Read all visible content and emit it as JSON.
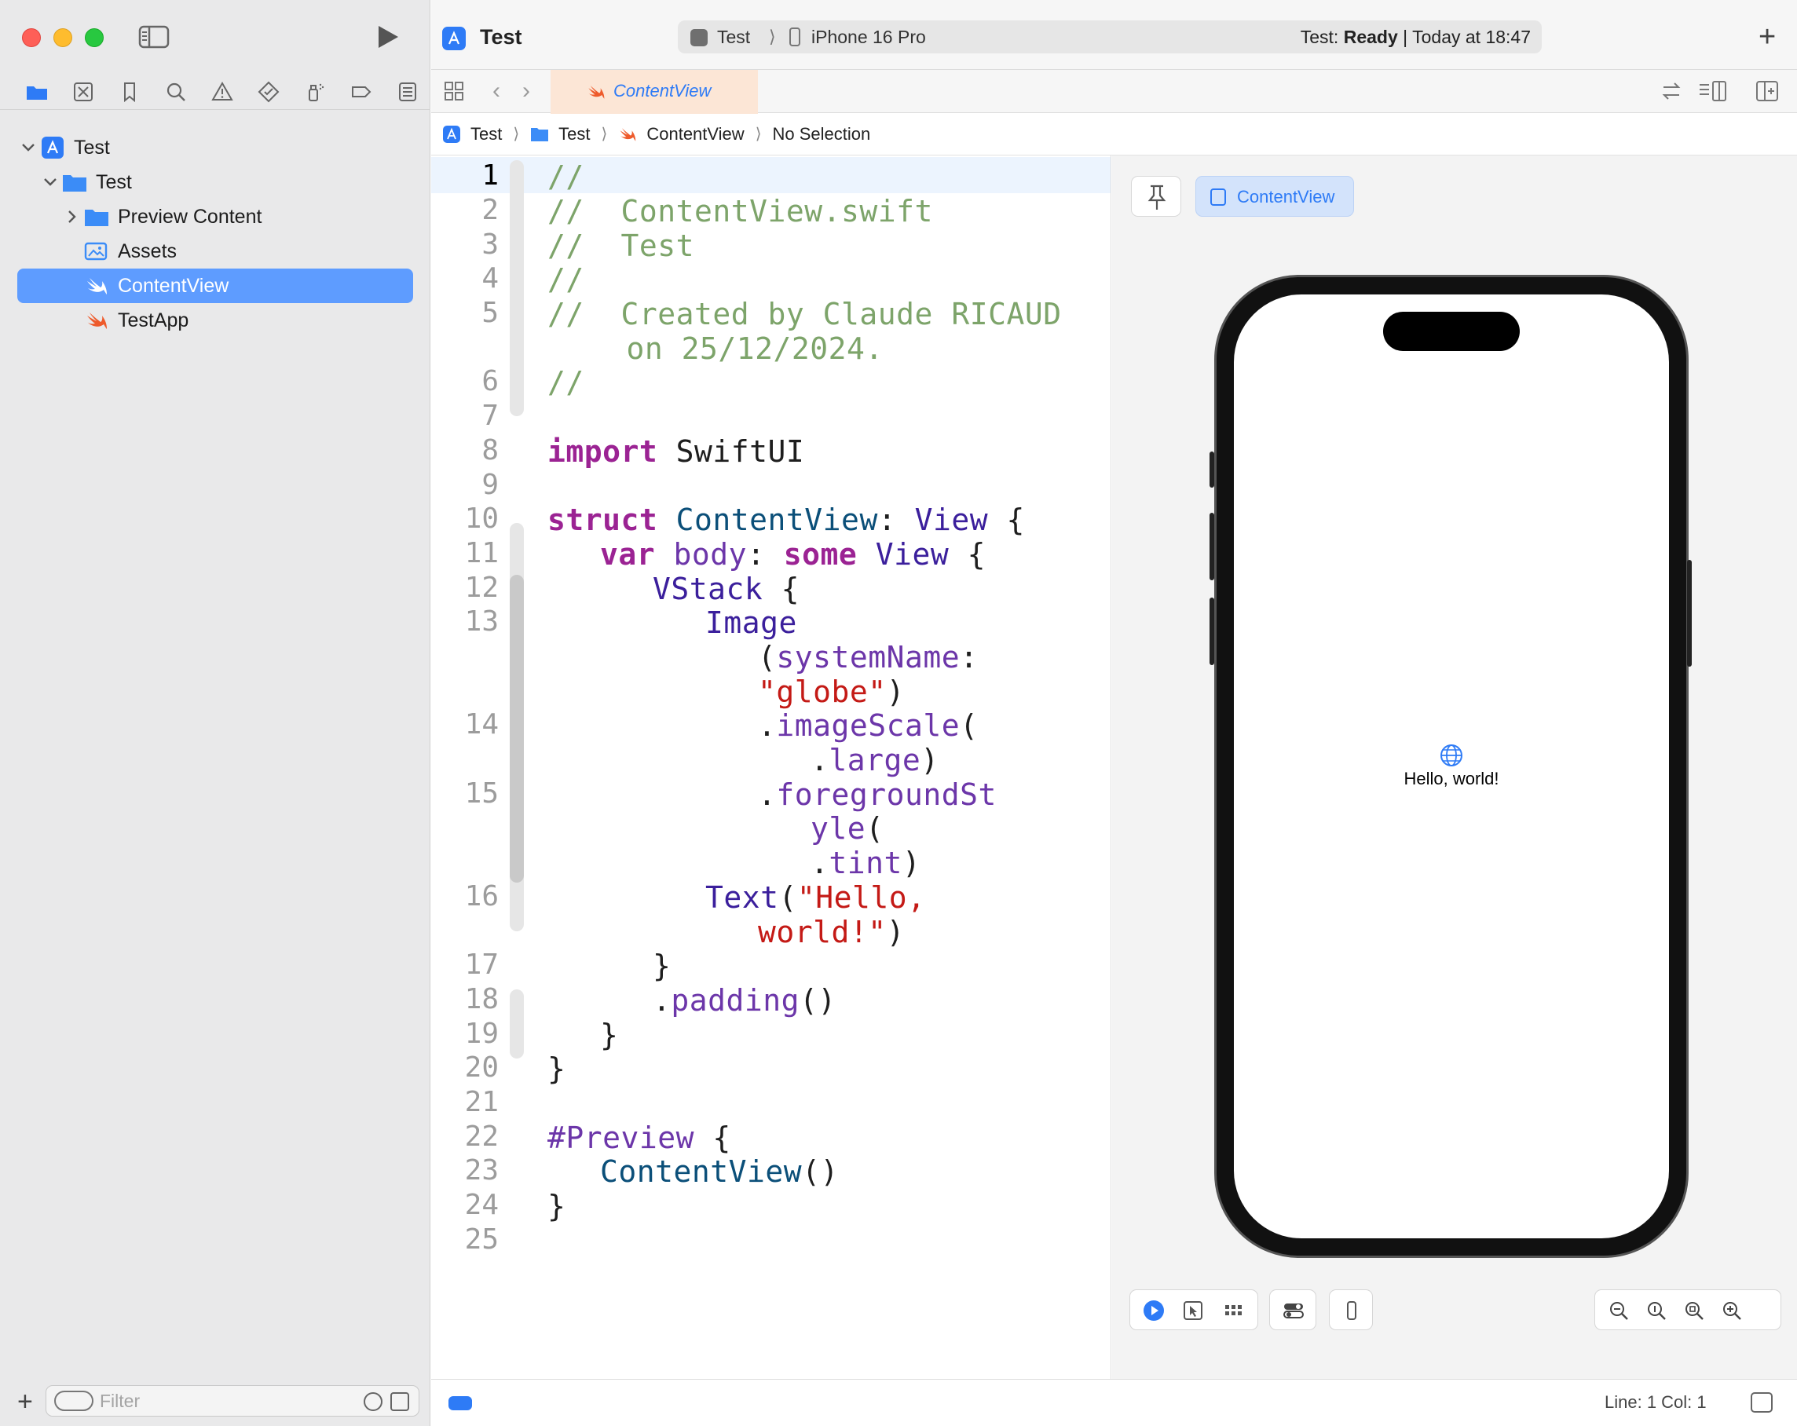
{
  "window": {
    "project_title": "Test",
    "activity": {
      "scheme": "Test",
      "separator": "⟩",
      "device": "iPhone 16 Pro",
      "status_prefix": "Test: ",
      "status_state": "Ready",
      "status_suffix": " | Today at 18:47"
    },
    "add_tab": "+"
  },
  "navigator": {
    "icons": [
      "folder-icon",
      "source-control-icon",
      "bookmark-icon",
      "search-icon",
      "warning-icon",
      "test-icon",
      "debug-icon",
      "breakpoint-icon",
      "report-icon"
    ],
    "tree": [
      {
        "label": "Test",
        "icon": "app-project-icon",
        "expanded": true
      },
      {
        "label": "Test",
        "icon": "folder-icon",
        "expanded": true
      },
      {
        "label": "Preview Content",
        "icon": "folder-icon",
        "expanded": false
      },
      {
        "label": "Assets",
        "icon": "assets-icon"
      },
      {
        "label": "ContentView",
        "icon": "swift-icon",
        "selected": true
      },
      {
        "label": "TestApp",
        "icon": "swift-icon"
      }
    ],
    "filter_placeholder": "Filter",
    "add_label": "+"
  },
  "editor": {
    "tab_label": "ContentView",
    "breadcrumb": [
      "Test",
      "Test",
      "ContentView",
      "No Selection"
    ],
    "line_numbers": [
      "1",
      "2",
      "3",
      "4",
      "5",
      "6",
      "7",
      "8",
      "9",
      "10",
      "11",
      "12",
      "13",
      "14",
      "15",
      "16",
      "17",
      "18",
      "19",
      "20",
      "21",
      "22",
      "23",
      "24",
      "25"
    ],
    "active_line": "1",
    "code": {
      "l1": "//",
      "l2": "//  ContentView.swift",
      "l3": "//  Test",
      "l4": "//",
      "l5a": "//  Created by Claude RICAUD",
      "l5b": "on 25/12/2024.",
      "l6": "//",
      "l8_kw": "import",
      "l8_name": " SwiftUI",
      "l10_kw": "struct",
      "l10_name": " ContentView",
      "l10_colon": ": ",
      "l10_type": "View",
      "l10_brace": " {",
      "l11_kw": "var",
      "l11_prop": " body",
      "l11_colon": ": ",
      "l11_kw2": "some",
      "l11_type": " View",
      "l11_brace": " {",
      "l12_type": "VStack",
      "l12_brace": " {",
      "l13_type": "Image",
      "l13b_paren": "(",
      "l13b_arg": "systemName",
      "l13b_colon": ":",
      "l13c_str": "\"globe\"",
      "l13c_close": ")",
      "l14_dot": ".",
      "l14_fn": "imageScale",
      "l14_paren": "(",
      "l14b_dot": ".",
      "l14b_val": "large",
      "l14b_close": ")",
      "l15_dot": ".",
      "l15_fn": "foregroundSt",
      "l15b_fn": "yle",
      "l15b_paren": "(",
      "l15c_dot": ".",
      "l15c_val": "tint",
      "l15c_close": ")",
      "l16_type": "Text",
      "l16_paren": "(",
      "l16_str": "\"Hello,",
      "l16b_str": "world!\"",
      "l16b_close": ")",
      "l17": "}",
      "l18_dot": ".",
      "l18_fn": "padding",
      "l18_paren": "()",
      "l19": "}",
      "l20": "}",
      "l22_kw": "#Preview",
      "l22_brace": " {",
      "l23_name": "ContentView",
      "l23_paren": "()",
      "l24": "}"
    }
  },
  "canvas": {
    "preview_label": "ContentView",
    "preview_text": "Hello, world!"
  },
  "statusbar": {
    "position": "Line: 1  Col: 1"
  }
}
